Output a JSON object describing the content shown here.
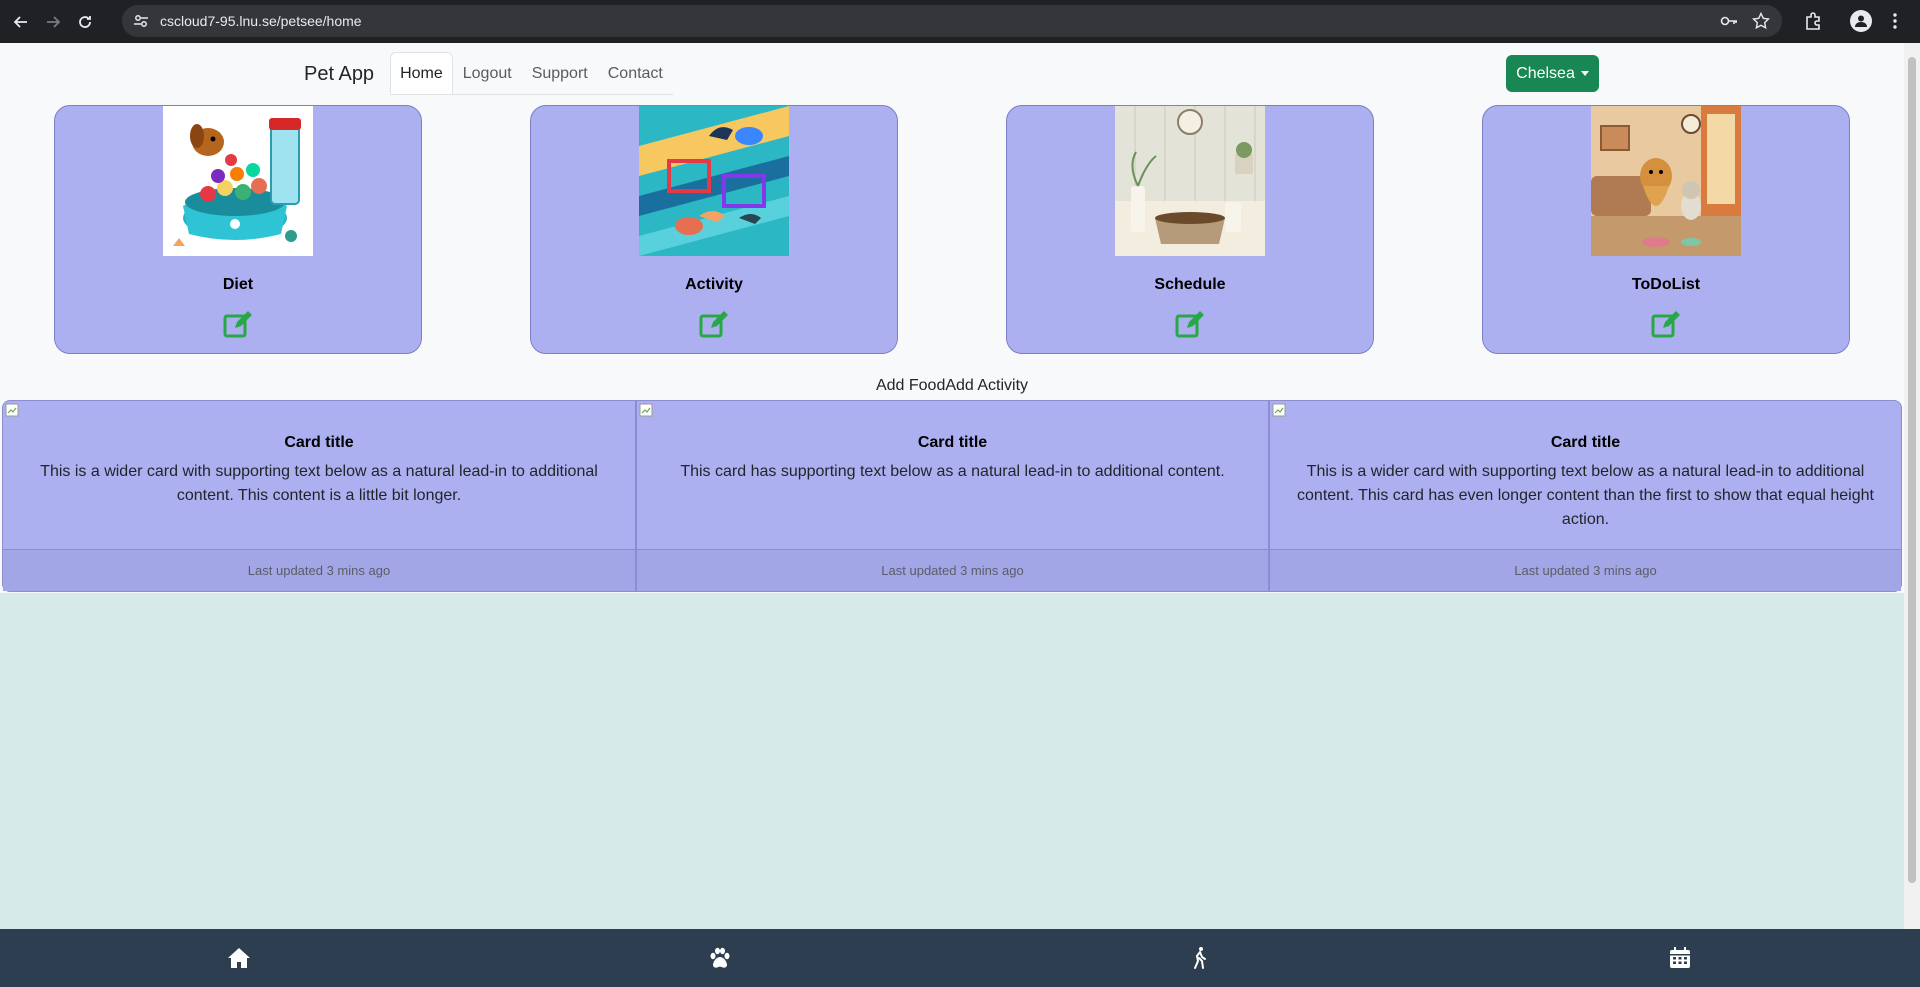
{
  "browser": {
    "url": "cscloud7-95.lnu.se/petsee/home"
  },
  "navbar": {
    "brand": "Pet App",
    "tabs": [
      {
        "label": "Home",
        "active": true
      },
      {
        "label": "Logout",
        "active": false
      },
      {
        "label": "Support",
        "active": false
      },
      {
        "label": "Contact",
        "active": false
      }
    ],
    "user_label": "Chelsea"
  },
  "features": [
    {
      "label": "Diet",
      "icon": "pencil-square-icon"
    },
    {
      "label": "Activity",
      "icon": "pencil-square-icon"
    },
    {
      "label": "Schedule",
      "icon": "pencil-square-icon"
    },
    {
      "label": "ToDoList",
      "icon": "pencil-square-icon"
    }
  ],
  "add_links": {
    "food": "Add Food",
    "activity": "Add Activity"
  },
  "cards": [
    {
      "title": "Card title",
      "text": "This is a wider card with supporting text below as a natural lead-in to additional content. This content is a little bit longer.",
      "footer": "Last updated 3 mins ago"
    },
    {
      "title": "Card title",
      "text": "This card has supporting text below as a natural lead-in to additional content.",
      "footer": "Last updated 3 mins ago"
    },
    {
      "title": "Card title",
      "text": "This is a wider card with supporting text below as a natural lead-in to additional content. This card has even longer content than the first to show that equal height action.",
      "footer": "Last updated 3 mins ago"
    }
  ],
  "bottom_nav": [
    "home-icon",
    "paw-icon",
    "walking-icon",
    "calendar-icon"
  ],
  "colors": {
    "card_bg": "#adb0f0",
    "user_button": "#198754",
    "edit_icon": "#28a745",
    "bottom_bar": "#2c3e50",
    "page_bg": "#d6ebe8"
  }
}
